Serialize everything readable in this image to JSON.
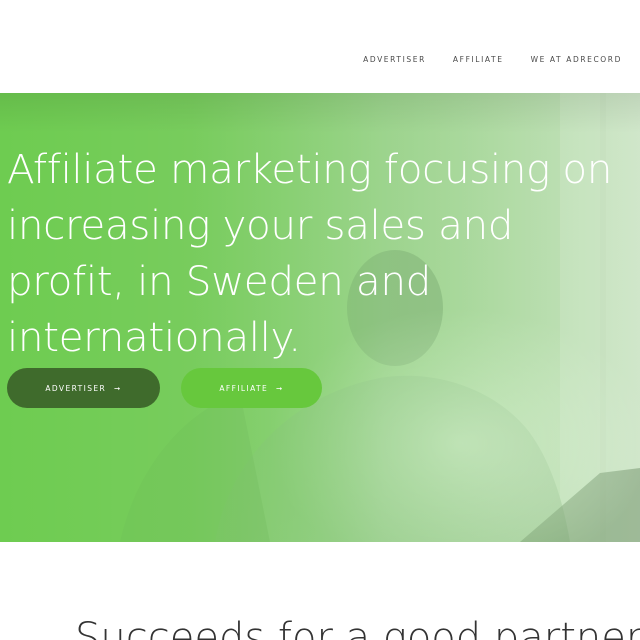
{
  "nav": {
    "items": [
      {
        "label": "ADVERTISER"
      },
      {
        "label": "AFFILIATE"
      },
      {
        "label": "WE AT ADRECORD"
      }
    ]
  },
  "hero": {
    "headline": "Affiliate marketing focusing on increasing your sales and profit, in Sweden and internationally.",
    "buttons": {
      "advertiser_label": "ADVERTISER",
      "affiliate_label": "AFFILIATE",
      "arrow": "➞"
    }
  },
  "section": {
    "heading": "Succeeds for a good partnership"
  },
  "colors": {
    "hero_green": "#76d058",
    "advertiser_button": "#3f6b2c",
    "affiliate_button": "#67c83d",
    "nav_text": "#4a4a4a"
  }
}
